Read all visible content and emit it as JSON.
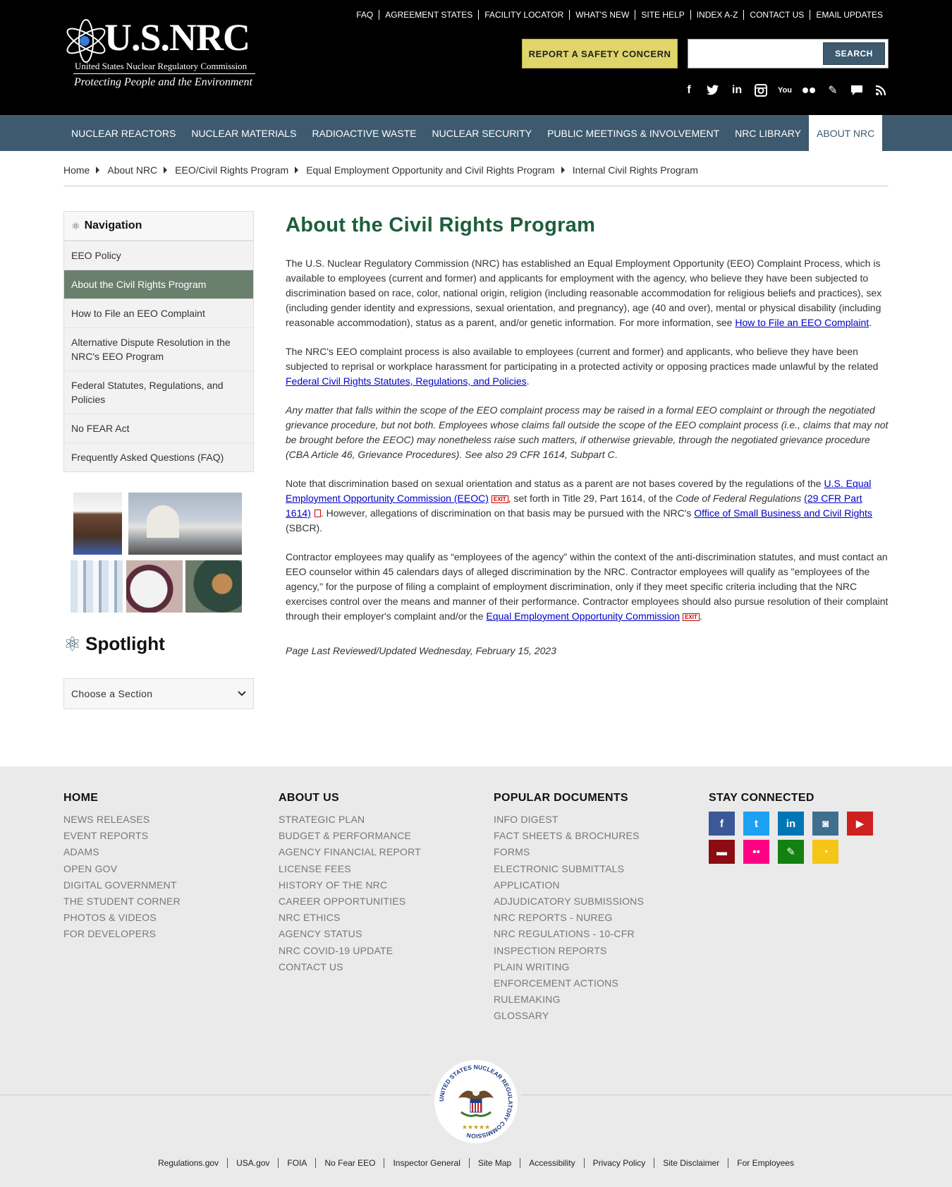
{
  "header": {
    "brand": "U.S.NRC",
    "agency": "United States Nuclear Regulatory Commission",
    "tagline": "Protecting People and the Environment",
    "top_links": [
      "FAQ",
      "AGREEMENT STATES",
      "FACILITY LOCATOR",
      "WHAT'S NEW",
      "SITE HELP",
      "INDEX A-Z",
      "CONTACT US",
      "EMAIL UPDATES"
    ],
    "report_button": "REPORT A SAFETY CONCERN",
    "search_placeholder": "",
    "search_button": "SEARCH",
    "social_icons": [
      "facebook-icon",
      "twitter-icon",
      "linkedin-icon",
      "instagram-icon",
      "youtube-icon",
      "flickr-icon",
      "blog-pencil-icon",
      "comment-icon",
      "rss-icon"
    ]
  },
  "mainnav": {
    "items": [
      "NUCLEAR REACTORS",
      "NUCLEAR MATERIALS",
      "RADIOACTIVE WASTE",
      "NUCLEAR SECURITY",
      "PUBLIC MEETINGS & INVOLVEMENT",
      "NRC LIBRARY",
      "ABOUT NRC"
    ],
    "active": "ABOUT NRC"
  },
  "breadcrumb": [
    "Home",
    "About NRC",
    "EEO/Civil Rights Program",
    "Equal Employment Opportunity and Civil Rights Program",
    "Internal Civil Rights Program"
  ],
  "sidebar": {
    "title": "Navigation",
    "items": [
      "EEO Policy",
      "About the Civil Rights Program",
      "How to File an EEO Complaint",
      "Alternative Dispute Resolution in the NRC's EEO Program",
      "Federal Statutes, Regulations, and Policies",
      "No FEAR Act",
      "Frequently Asked Questions (FAQ)"
    ],
    "active_item": "About the Civil Rights Program",
    "spotlight_title": "Spotlight",
    "choose_label": "Choose a Section"
  },
  "content": {
    "title": "About the Civil Rights Program",
    "p1_text": "The U.S. Nuclear Regulatory Commission (NRC) has established an Equal Employment Opportunity (EEO) Complaint Process, which is available to employees (current and former) and applicants for employment with the agency, who believe they have been subjected to discrimination based on race, color, national origin, religion (including reasonable accommodation for religious beliefs and practices), sex (including gender identity and expressions, sexual orientation, and pregnancy), age (40 and over), mental or physical disability (including reasonable accommodation), status as a parent, and/or genetic information. For more information, see ",
    "p1_link": "How to File an EEO Complaint",
    "p2_text": "The NRC's EEO complaint process is also available to employees (current and former) and applicants, who believe they have been subjected to reprisal or workplace harassment for participating in a protected activity or opposing practices made unlawful by the related ",
    "p2_link": "Federal Civil Rights Statutes, Regulations, and Policies",
    "p3_italic": "Any matter that falls within the scope of the EEO complaint process may be raised in a formal EEO complaint or through the negotiated grievance procedure, but not both. Employees whose claims fall outside the scope of the EEO complaint process (i.e., claims that may not be brought before the EEOC) may nonetheless raise such matters, if otherwise grievable, through the negotiated grievance procedure (CBA Article 46, Grievance Procedures). See also 29 CFR 1614, Subpart C",
    "p4_a": "Note that discrimination based on sexual orientation and status as a parent are not bases covered by the regulations of the ",
    "p4_link1": "U.S. Equal Employment Opportunity Commission (EEOC)",
    "p4_b": ", set forth in Title 29, Part 1614, of the ",
    "p4_cfr": "Code of Federal Regulations",
    "p4_link2": "(29 CFR Part 1614)",
    "p4_c": ". However, allegations of discrimination on that basis may be pursued with the NRC's ",
    "p4_link3": "Office of Small Business and Civil Rights",
    "p4_d": " (SBCR).",
    "p5_text": "Contractor employees may qualify as “employees of the agency” within the context of the anti-discrimination statutes, and must contact an EEO counselor within 45 calendars days of alleged discrimination by the NRC. Contractor employees will qualify as \"employees of the agency,\" for the purpose of filing a complaint of employment discrimination, only if they meet specific criteria including that the NRC exercises control over the means and manner of their performance. Contractor employees should also pursue resolution of their complaint through their employer's complaint and/or the ",
    "p5_link": "Equal Employment Opportunity Commission",
    "exit_label": "EXIT",
    "updated": "Page Last Reviewed/Updated Wednesday, February 15, 2023"
  },
  "footer": {
    "columns": [
      {
        "title": "HOME",
        "items": [
          "NEWS RELEASES",
          "EVENT REPORTS",
          "ADAMS",
          "OPEN GOV",
          "DIGITAL GOVERNMENT",
          "THE STUDENT CORNER",
          "PHOTOS & VIDEOS",
          "FOR DEVELOPERS"
        ]
      },
      {
        "title": "ABOUT US",
        "items": [
          "STRATEGIC PLAN",
          "BUDGET & PERFORMANCE",
          "AGENCY FINANCIAL REPORT",
          "LICENSE FEES",
          "HISTORY OF THE NRC",
          "CAREER OPPORTUNITIES",
          "NRC ETHICS",
          "AGENCY STATUS",
          "NRC COVID-19 UPDATE",
          "CONTACT US"
        ]
      },
      {
        "title": "POPULAR DOCUMENTS",
        "items": [
          "INFO DIGEST",
          "FACT SHEETS & BROCHURES",
          "FORMS",
          "ELECTRONIC SUBMITTALS",
          "APPLICATION",
          "ADJUDICATORY SUBMISSIONS",
          "NRC REPORTS - NUREG",
          "NRC REGULATIONS - 10-CFR",
          "INSPECTION REPORTS",
          "PLAIN WRITING",
          "ENFORCEMENT ACTIONS",
          "RULEMAKING",
          "GLOSSARY"
        ]
      }
    ],
    "stay_connected": "STAY CONNECTED",
    "social_buttons": [
      {
        "icon": "facebook-icon",
        "color": "#3b5998",
        "glyph": "f"
      },
      {
        "icon": "twitter-icon",
        "color": "#1da1f2",
        "glyph": "t"
      },
      {
        "icon": "linkedin-icon",
        "color": "#0077b5",
        "glyph": "in"
      },
      {
        "icon": "instagram-icon",
        "color": "#3f6f8f",
        "glyph": "◙"
      },
      {
        "icon": "youtube-icon",
        "color": "#cd201f",
        "glyph": "▶"
      },
      {
        "icon": "comment-icon",
        "color": "#8b0d12",
        "glyph": "▬"
      },
      {
        "icon": "flickr-icon",
        "color": "#ff0084",
        "glyph": "••"
      },
      {
        "icon": "blog-pencil-icon",
        "color": "#128112",
        "glyph": "✎"
      },
      {
        "icon": "rss-icon",
        "color": "#f5c518",
        "glyph": "◔"
      }
    ],
    "seal_text": "UNITED STATES NUCLEAR REGULATORY COMMISSION",
    "bottom_links": [
      "Regulations.gov",
      "USA.gov",
      "FOIA",
      "No Fear EEO",
      "Inspector General",
      "Site Map",
      "Accessibility",
      "Privacy Policy",
      "Site Disclaimer",
      "For Employees"
    ]
  }
}
